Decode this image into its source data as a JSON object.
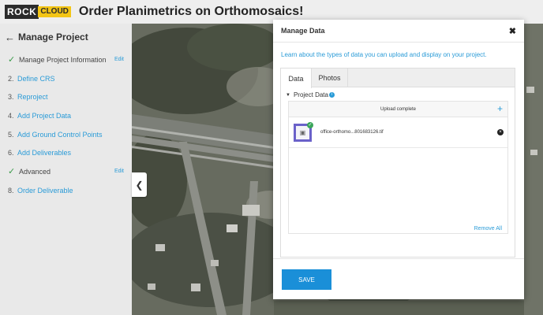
{
  "header": {
    "logo_rock": "ROCK",
    "logo_cloud": "CLOUD",
    "title": "Order Planimetrics on Orthomosaics!"
  },
  "sidebar": {
    "back_icon": "arrow-left-icon",
    "title": "Manage Project",
    "items": [
      {
        "marker": "✓",
        "label": "Manage Project Information",
        "done": true,
        "edit": "Edit"
      },
      {
        "marker": "2.",
        "label": "Define CRS",
        "done": false
      },
      {
        "marker": "3.",
        "label": "Reproject",
        "done": false
      },
      {
        "marker": "4.",
        "label": "Add Project Data",
        "done": false
      },
      {
        "marker": "5.",
        "label": "Add Ground Control Points",
        "done": false
      },
      {
        "marker": "6.",
        "label": "Add Deliverables",
        "done": false
      },
      {
        "marker": "✓",
        "label": "Advanced",
        "done": true,
        "edit": "Edit"
      },
      {
        "marker": "8.",
        "label": "Order Deliverable",
        "done": false
      }
    ]
  },
  "map": {
    "collapse_icon": "chevron-left-icon"
  },
  "modal": {
    "title": "Manage Data",
    "close_icon": "close-icon",
    "info": "Learn about the types of data you can upload and display on your project.",
    "tabs": [
      {
        "label": "Data",
        "active": true
      },
      {
        "label": "Photos",
        "active": false
      }
    ],
    "project_data_label": "Project Data",
    "upload_status": "Upload complete",
    "add_icon": "plus-icon",
    "files": [
      {
        "name": "office-orthomo...801683126.tif",
        "icon": "image-icon",
        "status_icon": "check-circle-icon",
        "remove_icon": "remove-circle-icon"
      }
    ],
    "remove_all": "Remove All",
    "save_label": "SAVE"
  },
  "colors": {
    "accent": "#2a9bd7",
    "save_button": "#1a8fd8",
    "check_green": "#3a9b4a",
    "logo_yellow": "#f3c515",
    "thumb_border": "#6a61c9"
  }
}
